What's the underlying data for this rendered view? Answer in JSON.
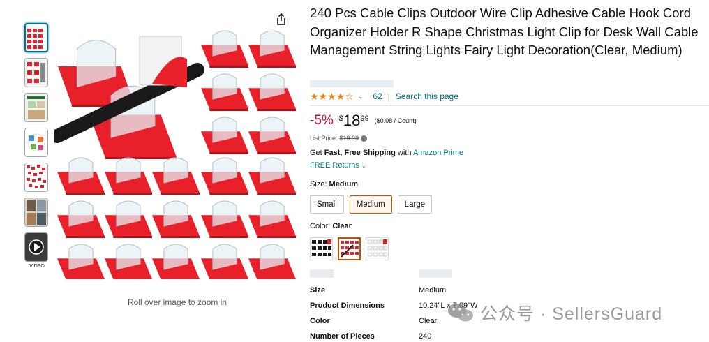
{
  "product": {
    "title": "240 Pcs Cable Clips Outdoor Wire Clip Adhesive Cable Hook Cord Organizer Holder R Shape Christmas Light Clip for Desk Wall Cable Management String Lights Fairy Light Decoration(Clear, Medium)",
    "rating": {
      "stars": 4.0,
      "count": "62",
      "separator": "|",
      "search_link": "Search this page"
    },
    "price": {
      "discount": "-5%",
      "symbol": "$",
      "whole": "18",
      "fraction": "99",
      "unit_price": "($0.08 / Count)"
    },
    "list_price": {
      "label": "List Price:",
      "value": "$19.99"
    },
    "shipping": {
      "prefix": "Get ",
      "bold": "Fast, Free Shipping",
      "middle": " with ",
      "prime": "Amazon Prime"
    },
    "returns": "FREE Returns",
    "size": {
      "label": "Size: ",
      "selected": "Medium",
      "options": [
        "Small",
        "Medium",
        "Large"
      ]
    },
    "color": {
      "label": "Color: ",
      "selected": "Clear"
    },
    "specs": [
      {
        "key": "Size",
        "value": "Medium"
      },
      {
        "key": "Product Dimensions",
        "value": "10.24\"L x 7.09\"W"
      },
      {
        "key": "Color",
        "value": "Clear"
      },
      {
        "key": "Number of Pieces",
        "value": "240"
      }
    ]
  },
  "gallery": {
    "video_label": "VIDEO",
    "rollover_hint": "Roll over image to zoom in"
  },
  "watermark": {
    "text": "公众号 · SellersGuard"
  },
  "colors": {
    "link": "#007185",
    "deal": "#CC0C39",
    "star": "#e87f13",
    "selected_border": "#c45500",
    "clip_red": "#e8202a"
  }
}
